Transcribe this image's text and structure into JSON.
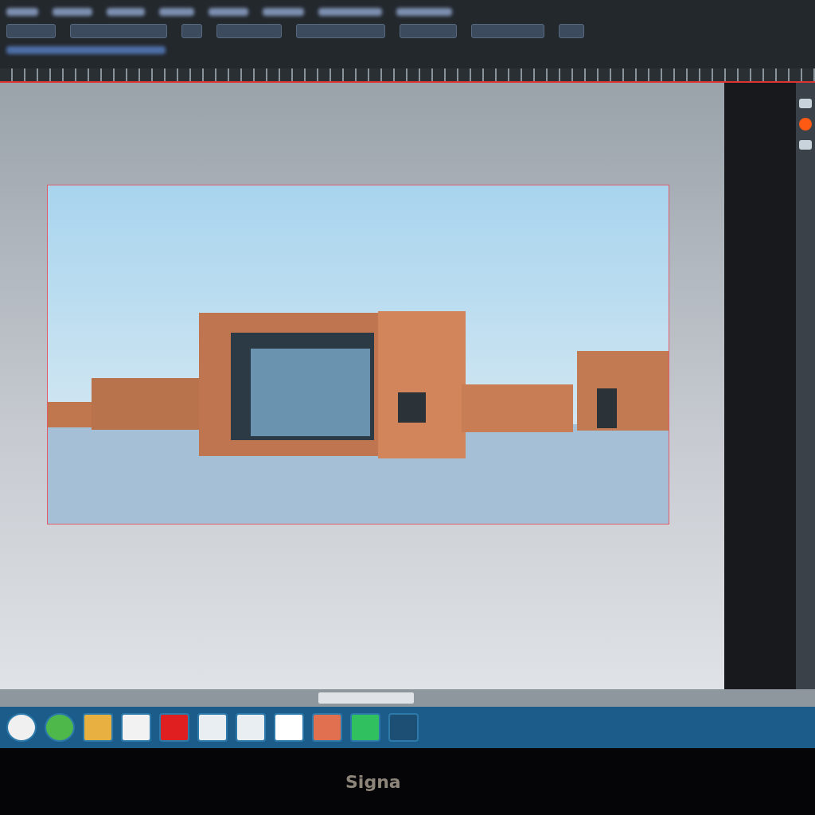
{
  "monitor": {
    "brand": "Signa"
  }
}
